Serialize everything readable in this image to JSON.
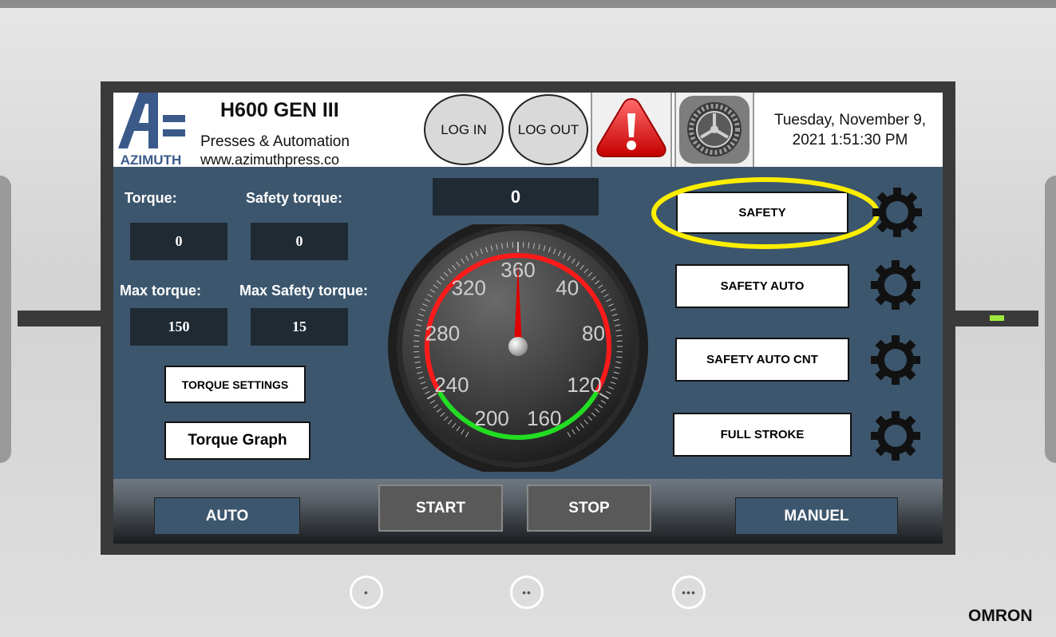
{
  "header": {
    "title": "H600 GEN III",
    "subtitle": "Presses & Automation",
    "website": "www.azimuthpress.co",
    "logo_text": "AZIMUTH",
    "login_label": "LOG IN",
    "logout_label": "LOG OUT",
    "datetime": "Tuesday, November 9, 2021 1:51:30 PM"
  },
  "readings": {
    "torque_label": "Torque:",
    "torque_value": "0",
    "safety_torque_label": "Safety torque:",
    "safety_torque_value": "0",
    "max_torque_label": "Max torque:",
    "max_torque_value": "150",
    "max_safety_torque_label": "Max Safety torque:",
    "max_safety_torque_value": "15"
  },
  "buttons": {
    "torque_settings": "TORQUE SETTINGS",
    "torque_graph": "Torque Graph",
    "safety": "SAFETY",
    "safety_auto": "SAFETY AUTO",
    "safety_auto_cnt": "SAFETY AUTO CNT",
    "full_stroke": "FULL STROKE"
  },
  "gauge": {
    "display_value": "0",
    "needle_value": 360,
    "tick_labels": [
      "360",
      "40",
      "80",
      "120",
      "160",
      "200",
      "240",
      "280",
      "320"
    ]
  },
  "bottom_bar": {
    "auto": "AUTO",
    "start": "START",
    "stop": "STOP",
    "manuel": "MANUEL"
  },
  "hardware_buttons": [
    "•",
    "••",
    "•••"
  ],
  "brand": "OMRON",
  "colors": {
    "panel": "#3c566d",
    "highlight_ellipse": "#ffee00",
    "gauge_red": "#ff1a1a",
    "gauge_green": "#22dd22",
    "led": "#9ee83c"
  }
}
